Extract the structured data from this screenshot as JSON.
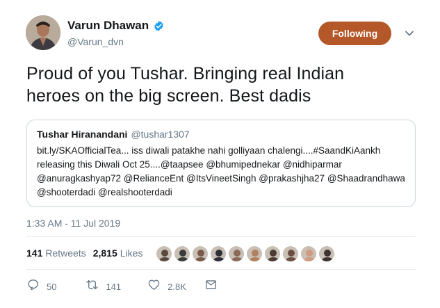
{
  "author": {
    "name": "Varun Dhawan",
    "handle": "@Varun_dvn",
    "verified": true
  },
  "follow_button": {
    "label": "Following",
    "color": "#b4582a"
  },
  "tweet": {
    "line1": "Proud of you Tushar. Bringing real Indian",
    "line2": "heroes on the big screen. Best dadis"
  },
  "quoted": {
    "name": "Tushar Hiranandani",
    "handle": "@tushar1307",
    "lines": [
      "bit.ly/SKAOfficialTea... iss diwali patakhe nahi golliyaan chalengi....#SaandKiAankh",
      "releasing this Diwali Oct 25....@taapsee @bhumipednekar @nidhiparmar",
      "@anuragkashyap72 @RelianceEnt @ItsVineetSingh @prakashjha27 @Shaadrandhawa",
      "@shooterdadi @realshooterdadi"
    ]
  },
  "timestamp": "1:33 AM - 11 Jul 2019",
  "stats": {
    "retweets_count": "141",
    "retweets_label": "Retweets",
    "likes_count": "2,815",
    "likes_label": "Likes"
  },
  "likers": [
    "#5a4a3e",
    "#3b3b3b",
    "#7a5b4b",
    "#2e2e38",
    "#8a6a58",
    "#b08060",
    "#4a3c32",
    "#6b4f42",
    "#d09a80",
    "#3c3030"
  ],
  "actions": {
    "replies": "50",
    "retweets": "141",
    "likes": "2.8K"
  },
  "colors": {
    "text": "#14171a",
    "secondary": "#657786",
    "verified": "#1da1f2",
    "border": "#ccd6dd"
  }
}
